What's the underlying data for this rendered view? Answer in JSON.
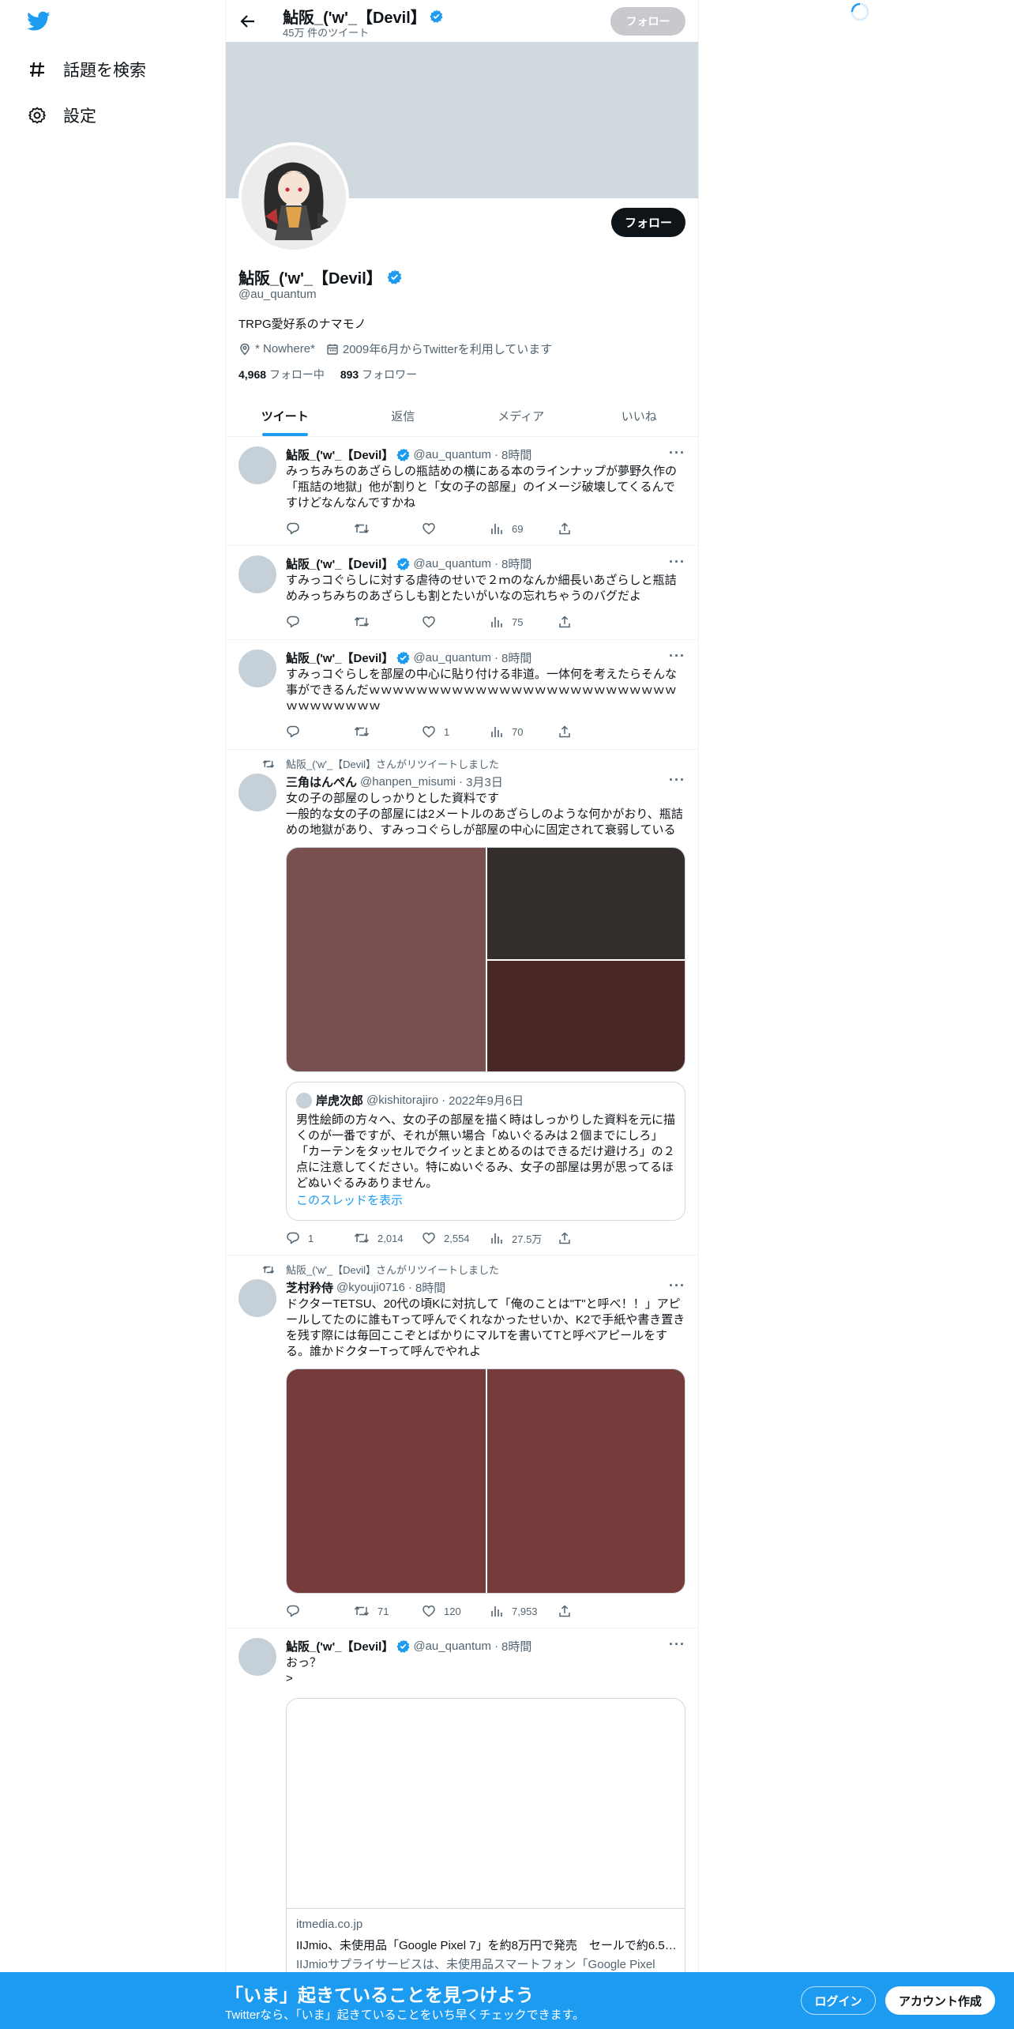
{
  "nav": {
    "explore_label": "話題を検索",
    "settings_label": "設定"
  },
  "header": {
    "name": "鮎阪_('w'_【Devil】",
    "tweet_count": "45万 件のツイート",
    "follow_label": "フォロー"
  },
  "profile": {
    "name": "鮎阪_('w'_【Devil】",
    "handle": "@au_quantum",
    "bio": "TRPG愛好系のナマモノ",
    "location": "* Nowhere*",
    "joined": "2009年6月からTwitterを利用しています",
    "following_count": "4,968",
    "following_label": "フォロー中",
    "followers_count": "893",
    "followers_label": "フォロワー",
    "follow_label": "フォロー"
  },
  "tabs": [
    "ツイート",
    "返信",
    "メディア",
    "いいね"
  ],
  "tweets": [
    {
      "name": "鮎阪_('w'_【Devil】",
      "handle": "@au_quantum",
      "time": "8時間",
      "text": "みっちみちのあざらしの瓶詰めの横にある本のラインナップが夢野久作の「瓶詰の地獄」他が割りと「女の子の部屋」のイメージ破壊してくるんですけどなんなんですかね",
      "reply": "",
      "retweet": "",
      "like": "",
      "views": "69"
    },
    {
      "name": "鮎阪_('w'_【Devil】",
      "handle": "@au_quantum",
      "time": "8時間",
      "text": "すみっコぐらしに対する虐待のせいで２ｍのなんか細長いあざらしと瓶詰めみっちみちのあざらしも割とたいがいなの忘れちゃうのバグだよ",
      "reply": "",
      "retweet": "",
      "like": "",
      "views": "75"
    },
    {
      "name": "鮎阪_('w'_【Devil】",
      "handle": "@au_quantum",
      "time": "8時間",
      "text": "すみっコぐらしを部屋の中心に貼り付ける非道。一体何を考えたらそんな事ができるんだｗｗｗｗｗｗｗｗｗｗｗｗｗｗｗｗｗｗｗｗｗｗｗｗｗｗｗｗｗｗｗｗｗｗ",
      "reply": "",
      "retweet": "",
      "like": "1",
      "views": "70"
    },
    {
      "retweeted_by": "鮎阪_('w'_【Devil】さんがリツイートしました",
      "name": "三角はんぺん",
      "handle": "@hanpen_misumi",
      "time": "3月3日",
      "text": "女の子の部屋のしっかりとした資料です\n一般的な女の子の部屋には2メートルのあざらしのような何かがおり、瓶詰めの地獄があり、すみっコぐらしが部屋の中心に固定されて衰弱している",
      "quote": {
        "name": "岸虎次郎",
        "handle": "@kishitorajiro",
        "time": "2022年9月6日",
        "text": "男性絵師の方々へ、女の子の部屋を描く時はしっかりした資料を元に描くのが一番ですが、それが無い場合「ぬいぐるみは２個までにしろ」「カーテンをタッセルでクイッとまとめるのはできるだけ避けろ」の２点に注意してください。特にぬいぐるみ、女子の部屋は男が思ってるほどぬいぐるみありません。",
        "thread_link": "このスレッドを表示"
      },
      "reply": "1",
      "retweet": "2,014",
      "like": "2,554",
      "views": "27.5万"
    },
    {
      "retweeted_by": "鮎阪_('w'_【Devil】さんがリツイートしました",
      "name": "芝村矜侍",
      "handle": "@kyouji0716",
      "time": "8時間",
      "text": "ドクターTETSU、20代の頃Kに対抗して「俺のことは\"T\"と呼べ！！」アピールしてたのに誰もTって呼んでくれなかったせいか、K2で手紙や書き置きを残す際には毎回ここぞとばかりにマルTを書いてTと呼べアピールをする。誰かドクターTって呼んでやれよ",
      "reply": "",
      "retweet": "71",
      "like": "120",
      "views": "7,953"
    },
    {
      "name": "鮎阪_('w'_【Devil】",
      "handle": "@au_quantum",
      "time": "8時間",
      "text": "おっ？\n>",
      "card": {
        "domain": "itmedia.co.jp",
        "title": "IIJmio、未使用品「Google Pixel 7」を約8万円で発売　セールで約6.5…",
        "desc": "IIJmioサプライサービスは、未使用品スマートフォン「Google Pixel"
      }
    }
  ],
  "bottom": {
    "title": "「いま」起きていることを見つけよう",
    "subtitle": "Twitterなら、「いま」起きていることをいち早くチェックできます。",
    "login": "ログイン",
    "signup": "アカウント作成"
  },
  "colors": {
    "accent": "#1d9bf0",
    "banner": "#cfd9de",
    "media1_left": "#7a4f4f",
    "media1_top_right": "#332e2c",
    "media1_bottom_right": "#4a2828",
    "media2": "#763b3b"
  }
}
